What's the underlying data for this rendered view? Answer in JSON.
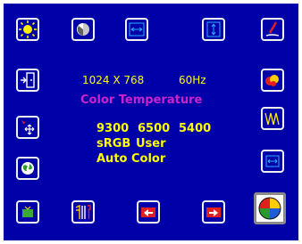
{
  "osd": {
    "info": {
      "resolution": "1024 X 768",
      "refresh": "60Hz"
    },
    "section_title": "Color Temperature",
    "options": {
      "t9300": "9300",
      "t6500": "6500",
      "t5400": "5400",
      "srgb": "sRGB",
      "user": "User",
      "auto_color": "Auto Color"
    }
  },
  "icons": {
    "top_row": [
      "brightness-icon",
      "contrast-icon",
      "h-size-icon",
      "v-size-icon",
      "pencil-icon"
    ],
    "left_column": [
      "exit-icon",
      "position-icon",
      "language-icon"
    ],
    "right_column": [
      "color-icon",
      "waveform-icon",
      "h-position-icon"
    ],
    "bottom_row": [
      "tv-icon",
      "tools-icon",
      "import-icon",
      "export-icon",
      "color-temperature-icon"
    ]
  },
  "colors": {
    "screen_background": "#0000a8",
    "text": "#ffff00",
    "title": "#cc22cc",
    "icon_border": "#f0f0f0",
    "selected_frame": "#8a8a8a"
  }
}
